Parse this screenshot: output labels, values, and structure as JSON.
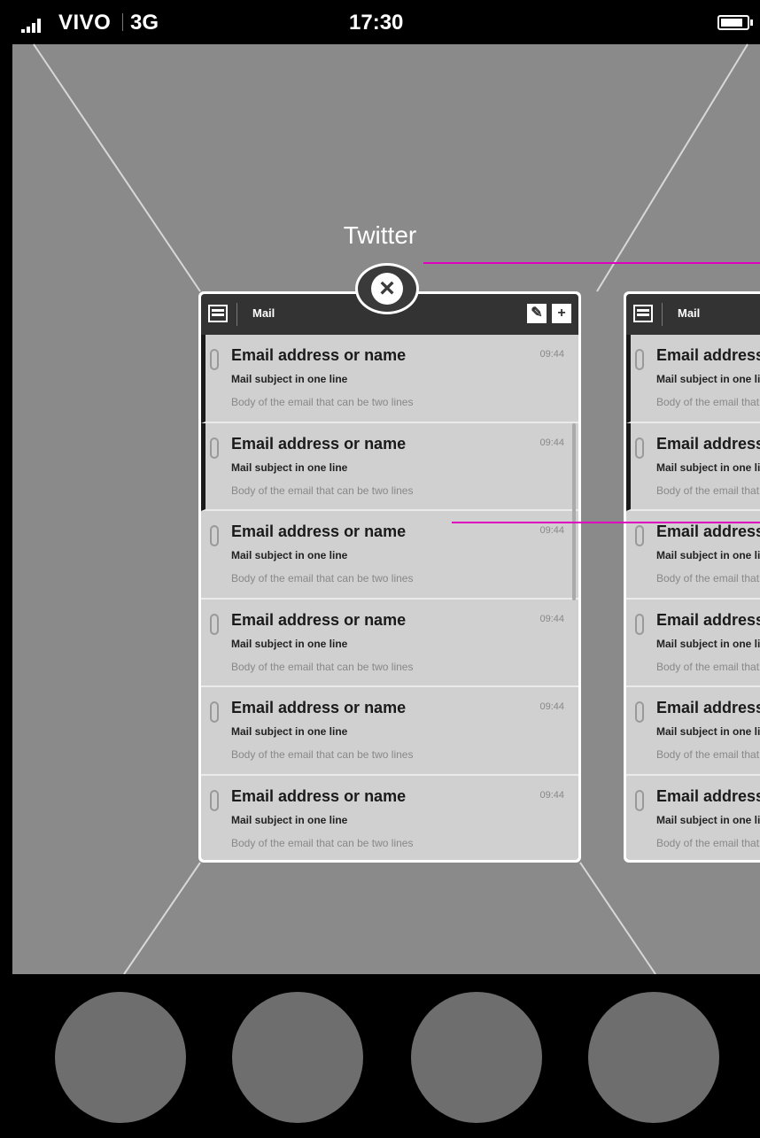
{
  "status_bar": {
    "carrier": "VIVO",
    "network": "3G",
    "time": "17:30",
    "signal_bars": 4,
    "battery_level": 0.85,
    "signal_icon": "signal-bars-icon",
    "battery_icon": "battery-icon"
  },
  "switcher": {
    "app_title": "Twitter",
    "close_icon": "close-icon"
  },
  "cards": [
    {
      "header_title": "Mail",
      "compose_icon": "✎",
      "add_icon": "+",
      "mails": [
        {
          "from": "Email address or name",
          "time": "09:44",
          "subject": "Mail subject in one line",
          "body": "Body of the email that can be two lines",
          "unread": true
        },
        {
          "from": "Email address or name",
          "time": "09:44",
          "subject": "Mail subject in one line",
          "body": "Body of the email that can be two lines",
          "unread": true
        },
        {
          "from": "Email address or name",
          "time": "09:44",
          "subject": "Mail subject in one line",
          "body": "Body of the email that can be two lines",
          "unread": false
        },
        {
          "from": "Email address or name",
          "time": "09:44",
          "subject": "Mail subject in one line",
          "body": "Body of the email that can be two lines",
          "unread": false
        },
        {
          "from": "Email address or name",
          "time": "09:44",
          "subject": "Mail subject in one line",
          "body": "Body of the email that can be two lines",
          "unread": false
        },
        {
          "from": "Email address or name",
          "time": "09:44",
          "subject": "Mail subject in one line",
          "body": "Body of the email that can be two lines",
          "unread": false
        }
      ]
    },
    {
      "header_title": "Mail",
      "mails": [
        {
          "from": "Email address or name",
          "subject": "Mail subject in one line",
          "body": "Body of the email that can be two lines",
          "unread": true
        },
        {
          "from": "Email address or name",
          "subject": "Mail subject in one line",
          "body": "Body of the email that can be two lines",
          "unread": true
        },
        {
          "from": "Email address or name",
          "subject": "Mail subject in one line",
          "body": "Body of the email that can be two lines",
          "unread": false
        },
        {
          "from": "Email address or name",
          "subject": "Mail subject in one line",
          "body": "Body of the email that can be two lines",
          "unread": false
        },
        {
          "from": "Email address or name",
          "subject": "Mail subject in one line",
          "body": "Body of the email that can be two lines",
          "unread": false
        },
        {
          "from": "Email address or name",
          "subject": "Mail subject in one line",
          "body": "Body of the email that can be two lines",
          "unread": false
        }
      ]
    }
  ],
  "dock": {
    "icons": [
      "app-icon-placeholder",
      "app-icon-placeholder",
      "app-icon-placeholder",
      "app-icon-placeholder"
    ]
  },
  "colors": {
    "background": "#8a8a8a",
    "annotation": "#e000c0",
    "dock": "#000000",
    "dock_icon": "#6e6e6e"
  }
}
